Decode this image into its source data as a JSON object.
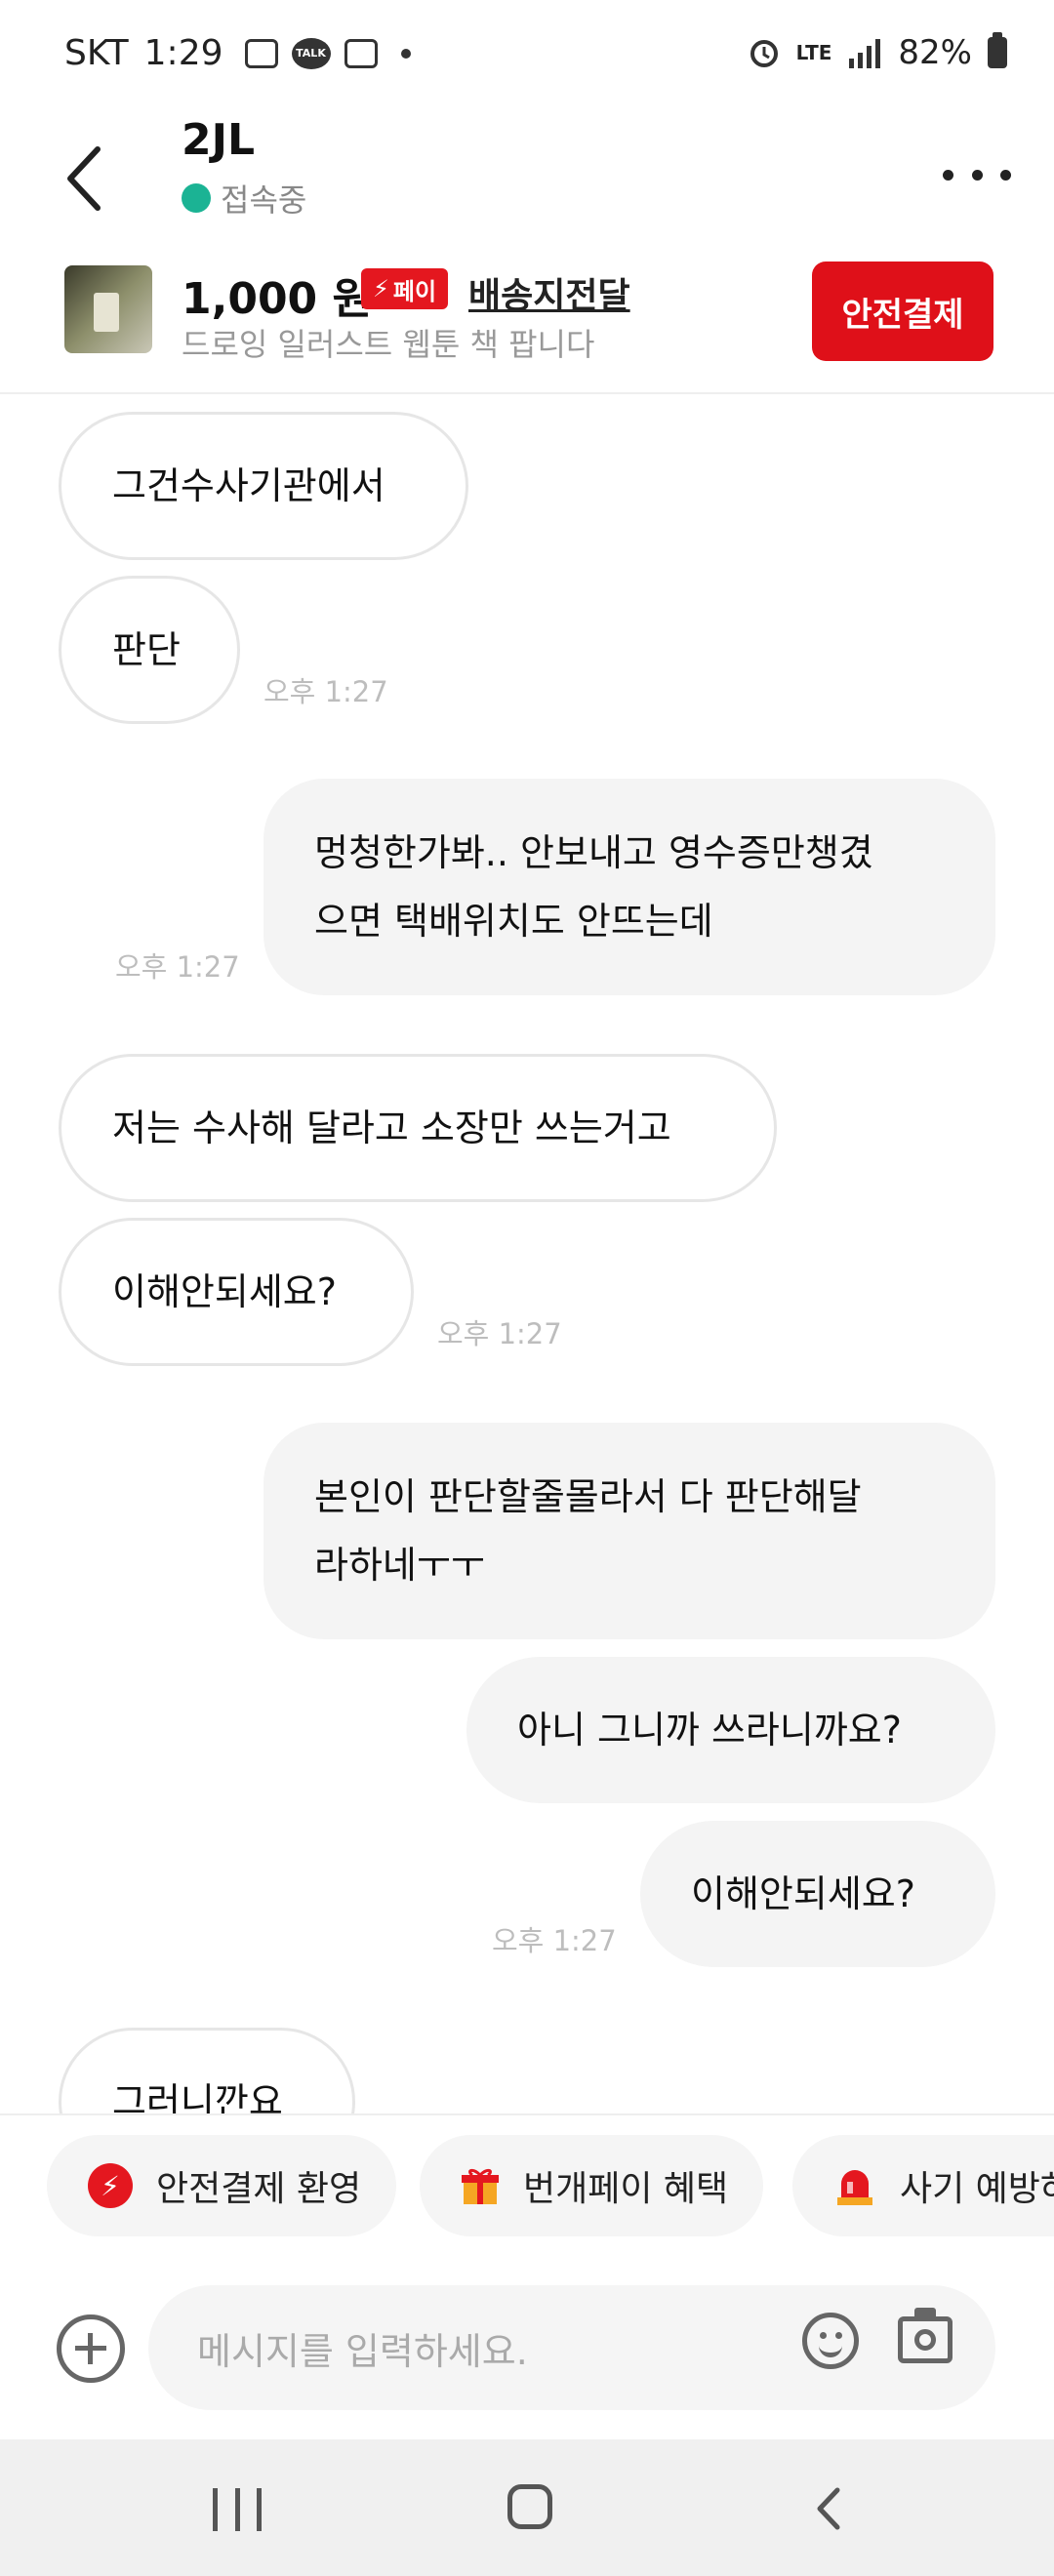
{
  "status_bar": {
    "carrier": "SKT",
    "time": "1:29",
    "talk_label": "TALK",
    "network": "LTE",
    "battery": "82%"
  },
  "header": {
    "title": "2JL",
    "status": "접속중"
  },
  "product": {
    "price": "1,000 원",
    "pay_badge": "페이",
    "shipping": "배송지전달",
    "description": "드로잉 일러스트 웹툰 책 팝니다",
    "safe_pay_button": "안전결제"
  },
  "messages": [
    {
      "side": "in",
      "text": "그건수사기관에서"
    },
    {
      "side": "in",
      "text": "판단",
      "time": "오후 1:27"
    },
    {
      "side": "out",
      "text": "멍청한가봐.. 안보내고 영수증만챙겼으면 택배위치도 안뜨는데",
      "lines": [
        "멍청한가봐.. 안보내고 영수증만챙겼",
        "으면 택배위치도 안뜨는데"
      ],
      "time": "오후 1:27"
    },
    {
      "side": "in",
      "text": "저는 수사해 달라고 소장만 쓰는거고"
    },
    {
      "side": "in",
      "text": "이해안되세요?",
      "time": "오후 1:27"
    },
    {
      "side": "out",
      "text": "본인이 판단할줄몰라서 다 판단해달라하네ㅜㅜ",
      "lines": [
        "본인이 판단할줄몰라서 다 판단해달",
        "라하네ㅜㅜ"
      ]
    },
    {
      "side": "out",
      "text": "아니 그니까 쓰라니까요?"
    },
    {
      "side": "out",
      "text": "이해안되세요?",
      "time": "오후 1:27"
    },
    {
      "side": "in",
      "text": "그러니깐요"
    }
  ],
  "quick_chips": [
    {
      "icon": "bolt-icon",
      "label": "안전결제 환영"
    },
    {
      "icon": "gift-icon",
      "label": "번개페이 혜택"
    },
    {
      "icon": "siren-icon",
      "label": "사기 예방하"
    }
  ],
  "input": {
    "placeholder": "메시지를 입력하세요."
  },
  "colors": {
    "accent_red": "#df1019",
    "online_green": "#1bb394"
  }
}
